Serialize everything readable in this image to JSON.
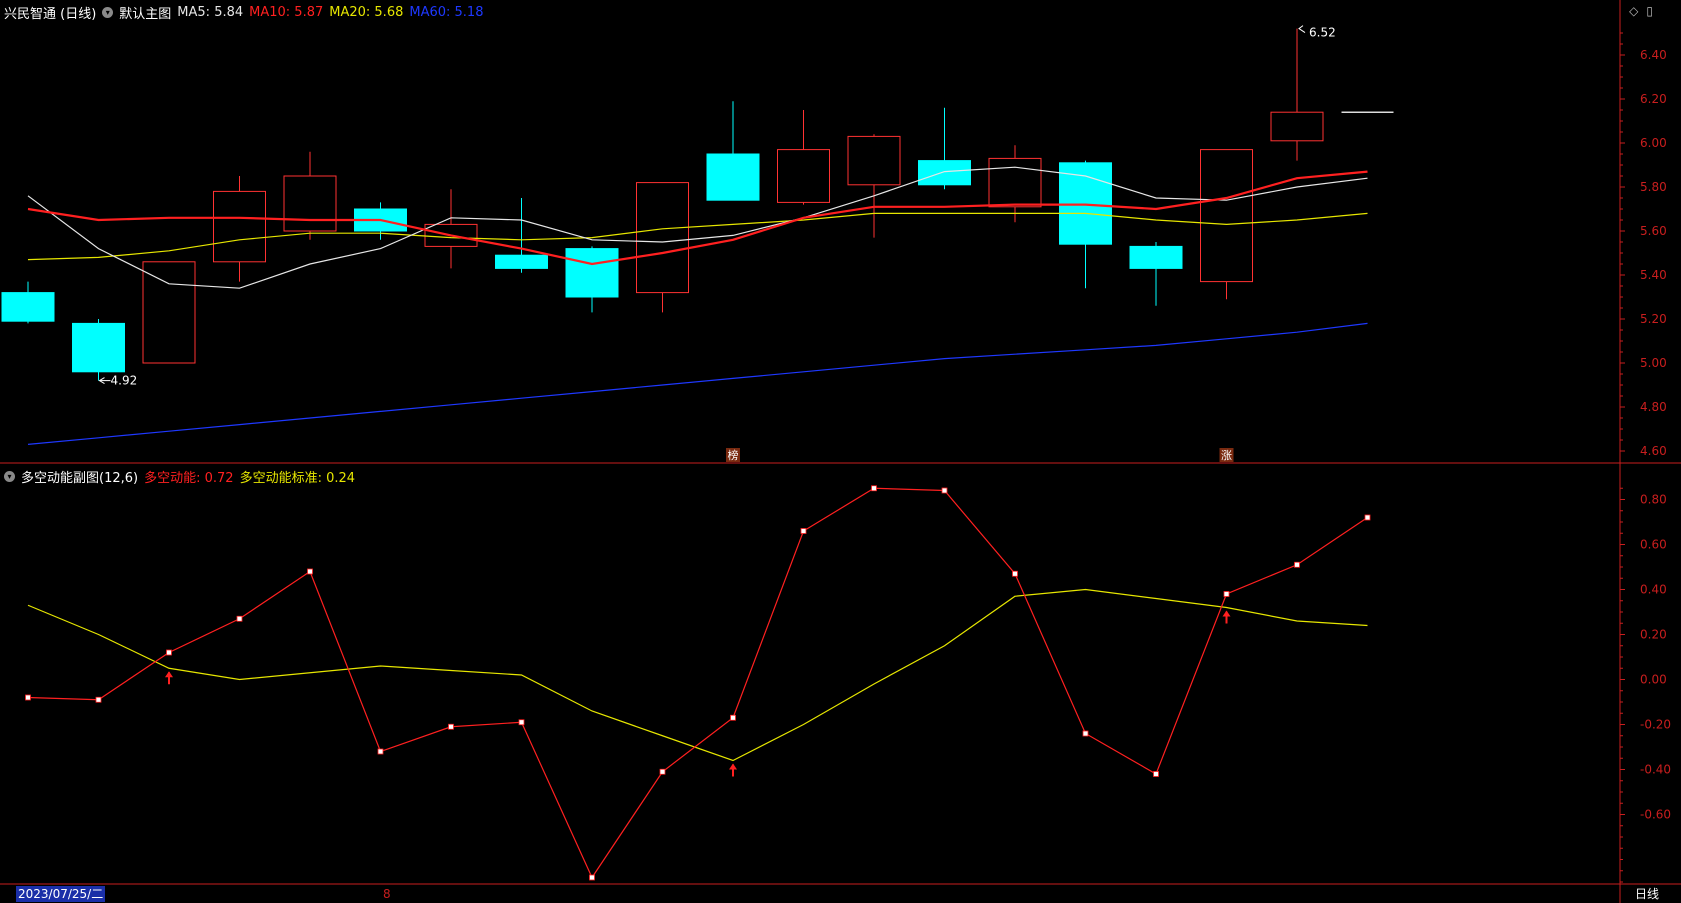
{
  "main": {
    "stock": "兴民智通 (日线)",
    "template": "默认主图",
    "ma": [
      {
        "label": "MA5: 5.84",
        "color": "#e6e6e6"
      },
      {
        "label": "MA10: 5.87",
        "color": "#ff2020"
      },
      {
        "label": "MA20: 5.68",
        "color": "#e6e600"
      },
      {
        "label": "MA60: 5.18",
        "color": "#1e38ff"
      }
    ],
    "y_ticks": [
      "6.40",
      "6.20",
      "6.00",
      "5.80",
      "5.60",
      "5.40",
      "5.20",
      "5.00",
      "4.80",
      "4.60"
    ],
    "high_label": "6.52",
    "low_label": "4.92",
    "badges": [
      "榜",
      "涨"
    ]
  },
  "sub": {
    "title": "多空动能副图(12,6)",
    "line1_label": "多空动能: 0.72",
    "line2_label": "多空动能标准: 0.24",
    "y_ticks": [
      "0.80",
      "0.60",
      "0.40",
      "0.20",
      "0.00",
      "-0.20",
      "-0.40",
      "-0.60"
    ]
  },
  "footer": {
    "date": "2023/07/25/二",
    "tick": "8",
    "period": "日线"
  },
  "colors": {
    "up": "#ff3232",
    "down": "#00ffff",
    "axis": "#c81e1e",
    "ma5": "#e6e6e6",
    "ma10": "#ff2020",
    "ma20": "#e6e600",
    "ma60": "#1e38ff",
    "momentum": "#ff2020",
    "standard": "#e6e600"
  },
  "chart_data": [
    {
      "type": "candlestick",
      "y_range": [
        4.55,
        6.55
      ],
      "candles": [
        {
          "o": 5.32,
          "h": 5.37,
          "l": 5.18,
          "c": 5.19
        },
        {
          "o": 5.18,
          "h": 5.2,
          "l": 4.92,
          "c": 4.96
        },
        {
          "o": 5.0,
          "h": 5.46,
          "l": 5.0,
          "c": 5.46
        },
        {
          "o": 5.46,
          "h": 5.85,
          "l": 5.37,
          "c": 5.78
        },
        {
          "o": 5.6,
          "h": 5.96,
          "l": 5.56,
          "c": 5.85
        },
        {
          "o": 5.7,
          "h": 5.73,
          "l": 5.56,
          "c": 5.6
        },
        {
          "o": 5.53,
          "h": 5.79,
          "l": 5.43,
          "c": 5.63
        },
        {
          "o": 5.49,
          "h": 5.75,
          "l": 5.41,
          "c": 5.43
        },
        {
          "o": 5.52,
          "h": 5.53,
          "l": 5.23,
          "c": 5.3
        },
        {
          "o": 5.32,
          "h": 5.82,
          "l": 5.23,
          "c": 5.82
        },
        {
          "o": 5.95,
          "h": 6.19,
          "l": 5.84,
          "c": 5.74
        },
        {
          "o": 5.73,
          "h": 6.15,
          "l": 5.72,
          "c": 5.97
        },
        {
          "o": 5.81,
          "h": 6.04,
          "l": 5.57,
          "c": 6.03
        },
        {
          "o": 5.92,
          "h": 6.16,
          "l": 5.79,
          "c": 5.81
        },
        {
          "o": 5.71,
          "h": 5.99,
          "l": 5.64,
          "c": 5.93
        },
        {
          "o": 5.91,
          "h": 5.92,
          "l": 5.34,
          "c": 5.54
        },
        {
          "o": 5.53,
          "h": 5.55,
          "l": 5.26,
          "c": 5.43
        },
        {
          "o": 5.37,
          "h": 5.97,
          "l": 5.29,
          "c": 5.97
        },
        {
          "o": 6.01,
          "h": 6.52,
          "l": 5.92,
          "c": 6.14
        },
        {
          "o": 6.14,
          "h": 6.14,
          "l": 6.14,
          "c": 6.14
        }
      ],
      "ma5": [
        5.76,
        5.52,
        5.36,
        5.34,
        5.45,
        5.52,
        5.66,
        5.65,
        5.56,
        5.55,
        5.58,
        5.66,
        5.76,
        5.87,
        5.89,
        5.85,
        5.75,
        5.74,
        5.8,
        5.84
      ],
      "ma10": [
        5.7,
        5.65,
        5.66,
        5.66,
        5.65,
        5.65,
        5.58,
        5.52,
        5.45,
        5.5,
        5.56,
        5.66,
        5.71,
        5.71,
        5.72,
        5.72,
        5.7,
        5.75,
        5.84,
        5.87
      ],
      "ma20": [
        5.47,
        5.48,
        5.51,
        5.56,
        5.59,
        5.59,
        5.57,
        5.56,
        5.57,
        5.61,
        5.63,
        5.65,
        5.68,
        5.68,
        5.68,
        5.68,
        5.65,
        5.63,
        5.65,
        5.68
      ],
      "ma60": [
        4.63,
        4.66,
        4.69,
        4.72,
        4.75,
        4.78,
        4.81,
        4.84,
        4.87,
        4.9,
        4.93,
        4.96,
        4.99,
        5.02,
        5.04,
        5.06,
        5.08,
        5.11,
        5.14,
        5.18
      ]
    },
    {
      "type": "line",
      "y_range": [
        -0.9,
        0.86
      ],
      "series": [
        {
          "name": "多空动能",
          "values": [
            -0.08,
            -0.09,
            0.12,
            0.27,
            0.48,
            -0.32,
            -0.21,
            -0.19,
            -0.88,
            -0.41,
            -0.17,
            0.66,
            0.85,
            0.84,
            0.47,
            -0.24,
            -0.42,
            0.38,
            0.51,
            0.72
          ]
        },
        {
          "name": "多空动能标准",
          "values": [
            0.33,
            0.2,
            0.05,
            0.0,
            0.03,
            0.06,
            0.04,
            0.02,
            -0.14,
            -0.25,
            -0.36,
            -0.2,
            -0.02,
            0.15,
            0.37,
            0.4,
            0.36,
            0.32,
            0.26,
            0.24
          ]
        }
      ],
      "signals": [
        2,
        10,
        17
      ]
    }
  ]
}
